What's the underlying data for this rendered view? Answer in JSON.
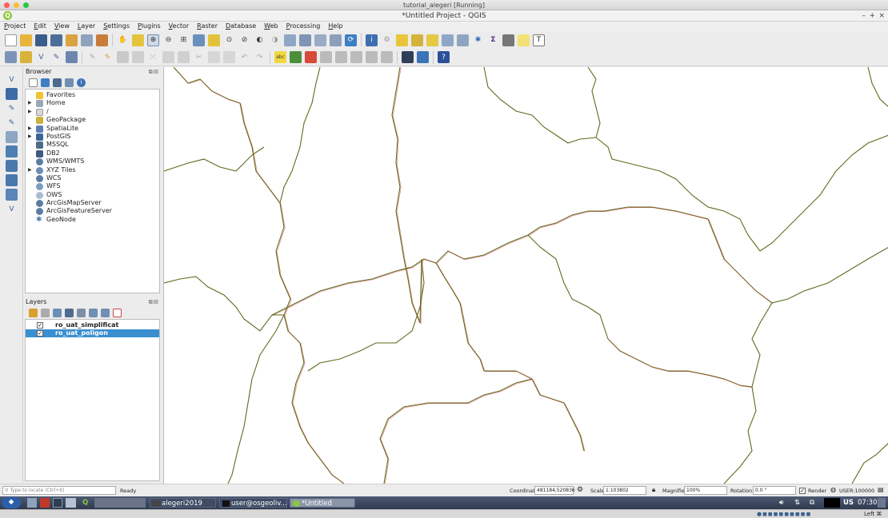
{
  "window": {
    "vm_title": "tutorial_alegeri [Running]",
    "qgis_title": "*Untitled Project - QGIS"
  },
  "menu": [
    "Project",
    "Edit",
    "View",
    "Layer",
    "Settings",
    "Plugins",
    "Vector",
    "Raster",
    "Database",
    "Web",
    "Processing",
    "Help"
  ],
  "browser": {
    "title": "Browser",
    "items": [
      {
        "label": "Favorites",
        "icon": "star-icon",
        "color": "#f2c230",
        "expand": false
      },
      {
        "label": "Home",
        "icon": "home-icon",
        "color": "#9aa7b5",
        "expand": true
      },
      {
        "label": "/",
        "icon": "folder-icon",
        "color": "#d7d7d7",
        "expand": true
      },
      {
        "label": "GeoPackage",
        "icon": "geopackage-icon",
        "color": "#c8b23a",
        "expand": false
      },
      {
        "label": "SpatiaLite",
        "icon": "spatialite-icon",
        "color": "#5b7fb5",
        "expand": true
      },
      {
        "label": "PostGIS",
        "icon": "postgis-icon",
        "color": "#3c6496",
        "expand": true
      },
      {
        "label": "MSSQL",
        "icon": "mssql-icon",
        "color": "#4d6c8a",
        "expand": false
      },
      {
        "label": "DB2",
        "icon": "db2-icon",
        "color": "#3d5a80",
        "expand": false
      },
      {
        "label": "WMS/WMTS",
        "icon": "wms-icon",
        "color": "#5a7da3",
        "expand": false
      },
      {
        "label": "XYZ Tiles",
        "icon": "xyz-tiles-icon",
        "color": "#6d8fb3",
        "expand": true
      },
      {
        "label": "WCS",
        "icon": "wcs-icon",
        "color": "#5a7da3",
        "expand": false
      },
      {
        "label": "WFS",
        "icon": "wfs-icon",
        "color": "#7b9cc0",
        "expand": false
      },
      {
        "label": "OWS",
        "icon": "ows-icon",
        "color": "#a9bcd1",
        "expand": false
      },
      {
        "label": "ArcGisMapServer",
        "icon": "arcgis-map-icon",
        "color": "#5a7da3",
        "expand": false
      },
      {
        "label": "ArcGisFeatureServer",
        "icon": "arcgis-feature-icon",
        "color": "#5a7da3",
        "expand": false
      },
      {
        "label": "GeoNode",
        "icon": "geonode-icon",
        "color": "#4f7fb0",
        "expand": false
      }
    ]
  },
  "layers": {
    "title": "Layers",
    "items": [
      {
        "label": "ro_uat_simplificat",
        "checked": "✓",
        "selected": false
      },
      {
        "label": "ro_uat_poligon",
        "checked": "✓",
        "selected": true
      }
    ]
  },
  "status": {
    "locate_placeholder": "Type to locate (Ctrl+K)",
    "ready": "Ready",
    "coordinate_label": "Coordinate",
    "coordinate_value": "481184,520836",
    "scale_label": "Scale",
    "scale_value": "1:103802",
    "magnifier_label": "Magnifier",
    "magnifier_value": "100%",
    "rotation_label": "Rotation",
    "rotation_value": "0.0 °",
    "render_label": "Render",
    "crs": "USER:100000"
  },
  "taskbar": {
    "folder": "alegeri2019",
    "terminal": "user@osgeoliv...",
    "qgis": "*Untitled Proje...",
    "keyboard": "US",
    "time": "07:30"
  },
  "bottom": {
    "host_key": "Left ⌘"
  },
  "colors": {
    "accent": "#3a8fd0",
    "boundary_green": "#5a6e1e",
    "boundary_red": "#d9343a"
  }
}
